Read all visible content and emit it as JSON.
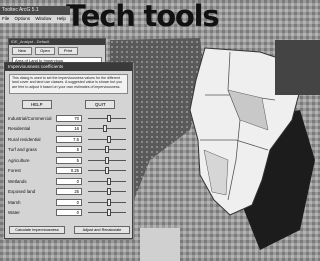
{
  "headline": "Tech tools",
  "app": {
    "title": "Tooltec ArcG 5.1",
    "menu": [
      "File",
      "Options",
      "Window",
      "Help"
    ]
  },
  "tool_window": {
    "title": "IDE_Analyst - Default",
    "buttons": [
      "New",
      "Open",
      "Print"
    ],
    "field_value": "Area of Land to Impervious"
  },
  "dialog": {
    "title": "Imperviousness coefficients",
    "description": "This dialog is used to set the imperviousness values for the different land cover and land use classes. A suggested value is shown but you are free to adjust it based on your own estimates of imperviousness.",
    "buttons": [
      "HELP",
      "QUIT"
    ],
    "params": [
      {
        "label": "Industrial/Commercial",
        "value": "70",
        "level": 0.55
      },
      {
        "label": "Residential",
        "value": "16",
        "level": 0.45
      },
      {
        "label": "Rural residential",
        "value": "7.5",
        "level": 0.55
      },
      {
        "label": "Turf and grass",
        "value": "5",
        "level": 0.5
      },
      {
        "label": "Agriculture",
        "value": "5",
        "level": 0.5
      },
      {
        "label": "Forest",
        "value": "0.25",
        "level": 0.5
      },
      {
        "label": "Wetlands",
        "value": "0",
        "level": 0.55
      },
      {
        "label": "Exposed land",
        "value": "25",
        "level": 0.55
      },
      {
        "label": "Marsh",
        "value": "0",
        "level": 0.55
      },
      {
        "label": "Water",
        "value": "0",
        "level": 0.55
      }
    ],
    "footer": [
      "Calculate Imperviousness",
      "Adjust and Recalculate"
    ]
  },
  "colors": {
    "map_light": "#ececec",
    "map_dark": "#1e1e1e",
    "map_mid": "#8c8c8c"
  }
}
